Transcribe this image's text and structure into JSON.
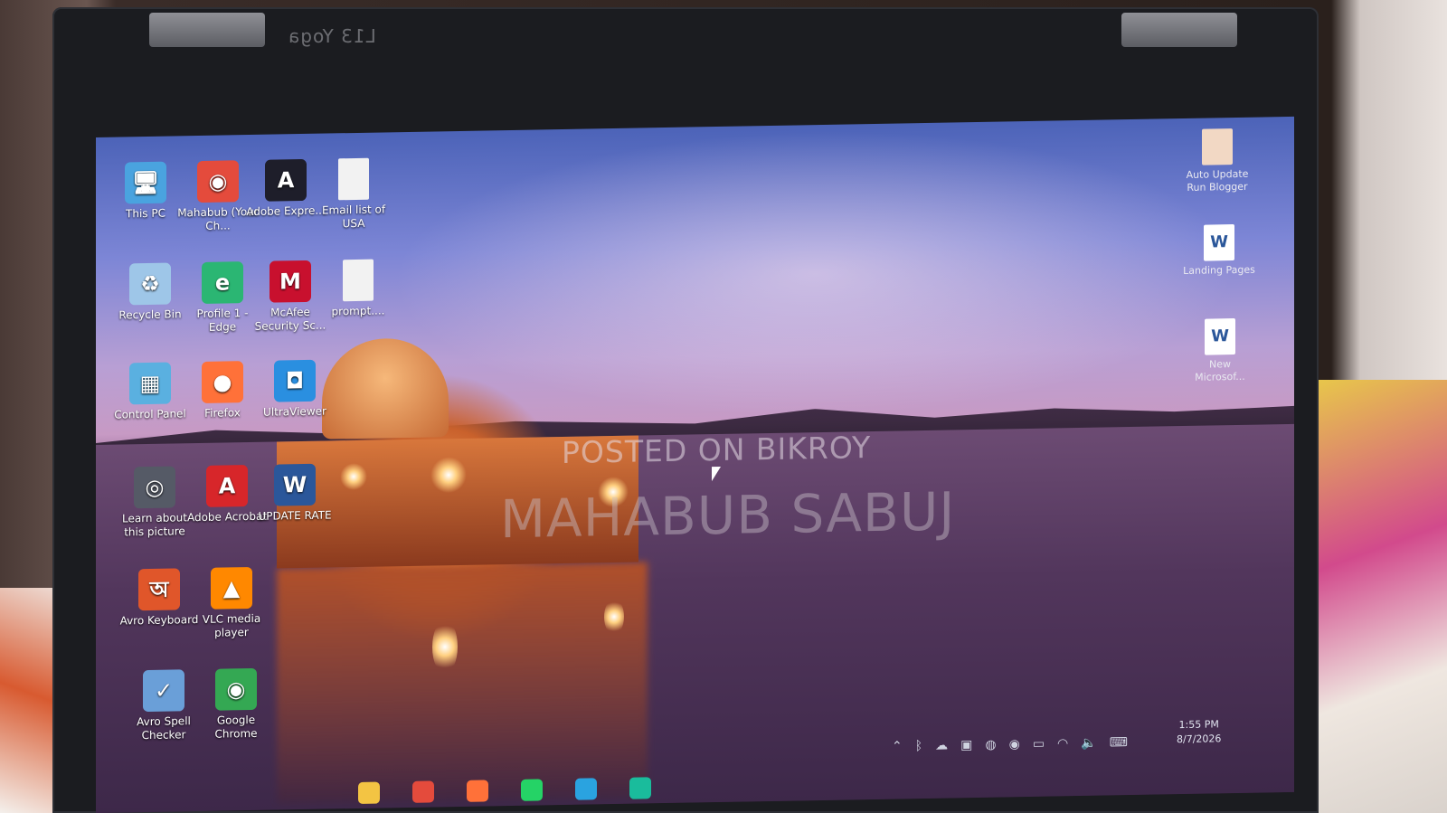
{
  "laptop": {
    "model_text": "L13 Yoga"
  },
  "desktop": {
    "icons": [
      {
        "label": "This PC",
        "icon": "this-pc-icon",
        "color": "#4aa3df"
      },
      {
        "label": "Mahabub (Your Ch...",
        "icon": "chrome-profile-icon",
        "color": "#e44b3c"
      },
      {
        "label": "Adobe Expre...",
        "icon": "adobe-express-icon",
        "color": "#1e1e2a"
      },
      {
        "label": "Email list of USA",
        "icon": "file-icon",
        "color": "#f2f2f2"
      },
      {
        "label": "Recycle Bin",
        "icon": "recycle-bin-icon",
        "color": "#9ec6e8"
      },
      {
        "label": "Profile 1 - Edge",
        "icon": "edge-icon",
        "color": "#2bb673"
      },
      {
        "label": "McAfee Security Sc...",
        "icon": "mcafee-icon",
        "color": "#c8102e"
      },
      {
        "label": "prompt....",
        "icon": "file-icon",
        "color": "#f2f2f2"
      },
      {
        "label": "Control Panel",
        "icon": "control-panel-icon",
        "color": "#5ab0e0"
      },
      {
        "label": "Firefox",
        "icon": "firefox-icon",
        "color": "#ff7139"
      },
      {
        "label": "UltraViewer",
        "icon": "ultraviewer-icon",
        "color": "#2a8fe0"
      },
      {
        "label": "Learn about this picture",
        "icon": "camera-icon",
        "color": "#555a66"
      },
      {
        "label": "Adobe Acrobat",
        "icon": "acrobat-icon",
        "color": "#d7262a"
      },
      {
        "label": "UPDATE RATE",
        "icon": "word-doc-icon",
        "color": "#2b579a"
      },
      {
        "label": "Avro Keyboard",
        "icon": "avro-keyboard-icon",
        "color": "#e0562a"
      },
      {
        "label": "VLC media player",
        "icon": "vlc-icon",
        "color": "#ff8800"
      },
      {
        "label": "Avro Spell Checker",
        "icon": "avro-spell-icon",
        "color": "#6a9fd8"
      },
      {
        "label": "Google Chrome",
        "icon": "chrome-icon",
        "color": "#34a853"
      }
    ],
    "right_icons": [
      {
        "label": "Auto Update Run Blogger",
        "icon": "file-icon"
      },
      {
        "label": "Landing Pages",
        "icon": "word-doc-icon"
      },
      {
        "label": "New Microsof...",
        "icon": "word-doc-icon"
      }
    ]
  },
  "watermark": {
    "line1": "POSTED ON BIKROY",
    "line2": "MAHABUB SABUJ"
  },
  "taskbar": {
    "time": "1:55 PM",
    "date": "8/7/2026",
    "tray_icons": [
      "chevron-up-icon",
      "bluetooth-icon",
      "cloud-icon",
      "device-icon",
      "meet-icon",
      "chrome-tray-icon",
      "battery-icon",
      "wifi-icon",
      "volume-icon",
      "keyboard-icon"
    ],
    "apps": [
      {
        "icon": "file-explorer-icon",
        "color": "#f3c443"
      },
      {
        "icon": "chrome-icon",
        "color": "#e44b3c"
      },
      {
        "icon": "firefox-icon",
        "color": "#ff7139"
      },
      {
        "icon": "whatsapp-icon",
        "color": "#25d366"
      },
      {
        "icon": "telegram-icon",
        "color": "#2aa3e0"
      },
      {
        "icon": "screen-recorder-icon",
        "color": "#1abc9c"
      }
    ]
  }
}
